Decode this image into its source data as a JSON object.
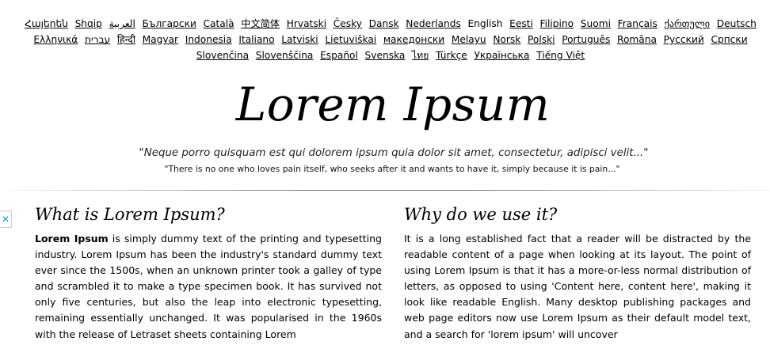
{
  "languages": [
    {
      "label": "Հայերեն",
      "current": false
    },
    {
      "label": "Shqip",
      "current": false
    },
    {
      "label": "العربية",
      "current": false
    },
    {
      "label": "Български",
      "current": false
    },
    {
      "label": "Català",
      "current": false
    },
    {
      "label": "中文简体",
      "current": false
    },
    {
      "label": "Hrvatski",
      "current": false
    },
    {
      "label": "Česky",
      "current": false
    },
    {
      "label": "Dansk",
      "current": false
    },
    {
      "label": "Nederlands",
      "current": false
    },
    {
      "label": "English",
      "current": true
    },
    {
      "label": "Eesti",
      "current": false
    },
    {
      "label": "Filipino",
      "current": false
    },
    {
      "label": "Suomi",
      "current": false
    },
    {
      "label": "Français",
      "current": false
    },
    {
      "label": "ქართული",
      "current": false
    },
    {
      "label": "Deutsch",
      "current": false
    },
    {
      "label": "Ελληνικά",
      "current": false
    },
    {
      "label": "עברית",
      "current": false
    },
    {
      "label": "हिन्दी",
      "current": false
    },
    {
      "label": "Magyar",
      "current": false
    },
    {
      "label": "Indonesia",
      "current": false
    },
    {
      "label": "Italiano",
      "current": false
    },
    {
      "label": "Latviski",
      "current": false
    },
    {
      "label": "Lietuviškai",
      "current": false
    },
    {
      "label": "македонски",
      "current": false
    },
    {
      "label": "Melayu",
      "current": false
    },
    {
      "label": "Norsk",
      "current": false
    },
    {
      "label": "Polski",
      "current": false
    },
    {
      "label": "Português",
      "current": false
    },
    {
      "label": "Româna",
      "current": false
    },
    {
      "label": "Pyccкий",
      "current": false
    },
    {
      "label": "Српски",
      "current": false
    },
    {
      "label": "Slovenčina",
      "current": false
    },
    {
      "label": "Slovenščina",
      "current": false
    },
    {
      "label": "Español",
      "current": false
    },
    {
      "label": "Svenska",
      "current": false
    },
    {
      "label": "ไทย",
      "current": false
    },
    {
      "label": "Türkçe",
      "current": false
    },
    {
      "label": "Українська",
      "current": false
    },
    {
      "label": "Tiếng Việt",
      "current": false
    }
  ],
  "header": {
    "title": "Lorem Ipsum",
    "quote_latin": "\"Neque porro quisquam est qui dolorem ipsum quia dolor sit amet, consectetur, adipisci velit...\"",
    "quote_english": "\"There is no one who loves pain itself, who seeks after it and wants to have it, simply because it is pain...\""
  },
  "ad": {
    "close_glyph": "✕"
  },
  "sections": {
    "what": {
      "heading": "What is Lorem Ipsum?",
      "lead_bold": "Lorem Ipsum",
      "body": " is simply dummy text of the printing and typesetting industry. Lorem Ipsum has been the industry's standard dummy text ever since the 1500s, when an unknown printer took a galley of type and scrambled it to make a type specimen book. It has survived not only five centuries, but also the leap into electronic typesetting, remaining essentially unchanged. It was popularised in the 1960s with the release of Letraset sheets containing Lorem"
    },
    "why": {
      "heading": "Why do we use it?",
      "body": "It is a long established fact that a reader will be distracted by the readable content of a page when looking at its layout. The point of using Lorem Ipsum is that it has a more-or-less normal distribution of letters, as opposed to using 'Content here, content here', making it look like readable English. Many desktop publishing packages and web page editors now use Lorem Ipsum as their default model text, and a search for 'lorem ipsum' will uncover"
    }
  }
}
